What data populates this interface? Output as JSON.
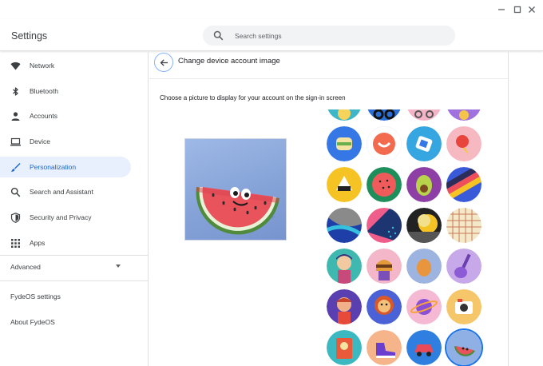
{
  "window": {
    "minimize_icon": "minimize-icon",
    "maximize_icon": "maximize-icon",
    "close_icon": "close-icon"
  },
  "header": {
    "app_title": "Settings",
    "search_placeholder": "Search settings",
    "search_value": ""
  },
  "sidebar": {
    "items": [
      {
        "label": "Network",
        "icon": "wifi-icon"
      },
      {
        "label": "Bluetooth",
        "icon": "bluetooth-icon"
      },
      {
        "label": "Accounts",
        "icon": "person-icon"
      },
      {
        "label": "Device",
        "icon": "laptop-icon"
      },
      {
        "label": "Personalization",
        "icon": "brush-icon",
        "active": true
      },
      {
        "label": "Search and Assistant",
        "icon": "search-icon"
      },
      {
        "label": "Security and Privacy",
        "icon": "shield-icon"
      },
      {
        "label": "Apps",
        "icon": "apps-grid-icon"
      }
    ],
    "advanced_label": "Advanced",
    "links": [
      "FydeOS settings",
      "About FydeOS"
    ]
  },
  "main": {
    "title": "Change device account image",
    "prompt": "Choose a picture to display for your account on the sign-in screen",
    "selected_image": "watermelon",
    "avatars": [
      "partial-1",
      "partial-2",
      "partial-3",
      "partial-4",
      "sandwich",
      "smile",
      "sticker",
      "ice-cream",
      "onigiri",
      "watermelon-slice",
      "avocado",
      "stripes",
      "abstract-blue",
      "abstract-pink",
      "moon",
      "grid-pattern",
      "girl-3d",
      "burger-3d",
      "egg-3d",
      "guitar-3d",
      "boy-3d",
      "lion-3d",
      "planet-3d",
      "camera-3d",
      "cassette-3d",
      "sneaker-3d",
      "car-3d",
      "watermelon-3d"
    ]
  },
  "colors": {
    "accent": "#1a73e8",
    "active_bg": "#e8f0fe",
    "active_text": "#1967d2"
  }
}
